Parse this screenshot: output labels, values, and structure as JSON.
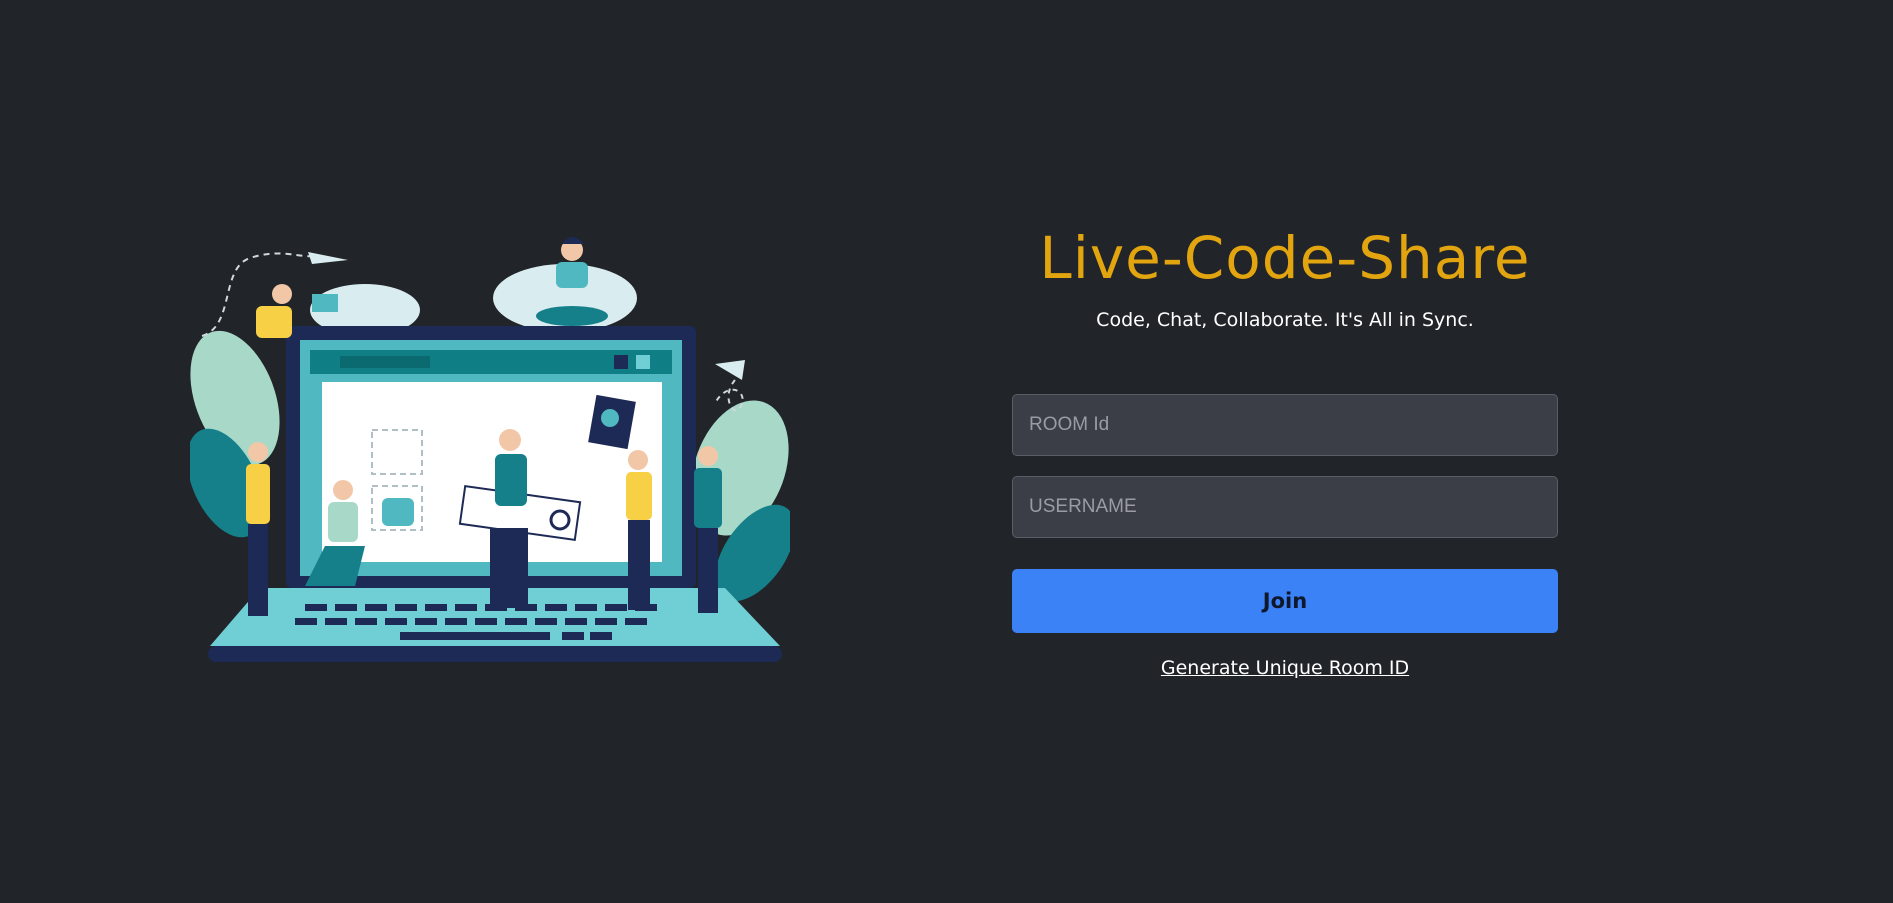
{
  "header": {
    "title": "Live-Code-Share",
    "tagline": "Code, Chat, Collaborate. It's All in Sync."
  },
  "form": {
    "room_placeholder": "ROOM Id",
    "room_value": "",
    "username_placeholder": "USERNAME",
    "username_value": "",
    "join_label": "Join",
    "generate_label": "Generate Unique Room ID"
  },
  "colors": {
    "background": "#212429",
    "title": "#e2a50f",
    "button": "#3b82f6",
    "input_bg": "#3c3e47"
  },
  "illustration": {
    "icon": "team-collaboration-illustration"
  }
}
